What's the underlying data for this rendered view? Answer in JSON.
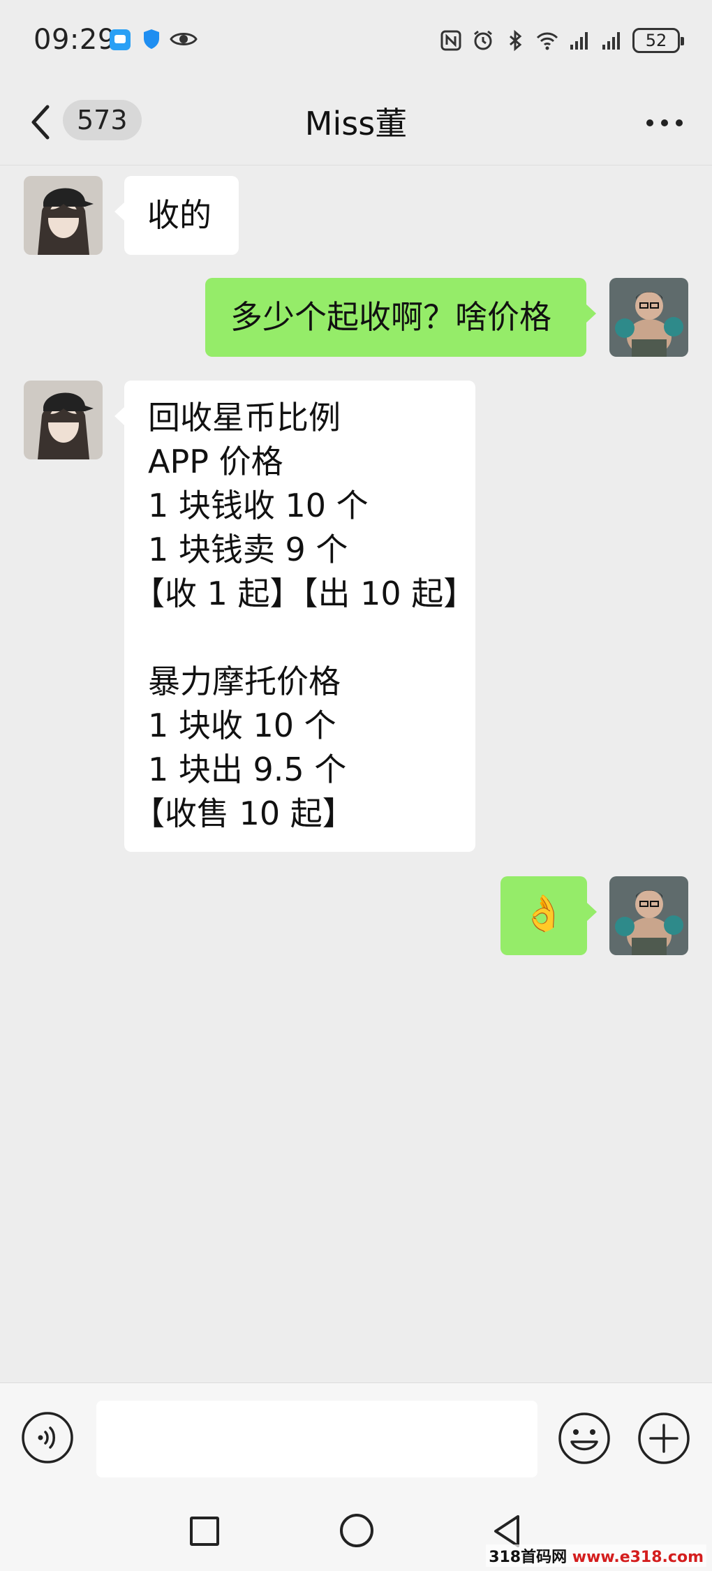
{
  "status_bar": {
    "time": "09:29",
    "battery": "52",
    "icons": [
      "message-app-icon",
      "shield-app-icon",
      "eye-icon",
      "nfc-icon",
      "alarm-icon",
      "bluetooth-icon",
      "wifi-icon",
      "signal-icon",
      "signal-icon",
      "battery-icon"
    ]
  },
  "header": {
    "back_icon": "chevron-left-icon",
    "unread_count": "573",
    "title": "Miss董",
    "more_icon": "more-dots-icon"
  },
  "messages": [
    {
      "side": "in",
      "lines": [
        "收的"
      ]
    },
    {
      "side": "out",
      "lines": [
        "多少个起收啊？啥价格"
      ]
    },
    {
      "side": "in",
      "lines": [
        "回收星币比例",
        "APP 价格",
        "1 块钱收 10 个",
        "1 块钱卖 9 个",
        "【收 1 起】【出 10 起】",
        "",
        "暴力摩托价格",
        "1 块收 10 个",
        "1 块出 9.5 个",
        "【收售 10 起】"
      ]
    },
    {
      "side": "out",
      "emoji": "ok-hand-emoji",
      "lines": [
        "👌"
      ]
    }
  ],
  "input_bar": {
    "voice_icon": "voice-icon",
    "text_value": "",
    "emoji_icon": "emoji-icon",
    "plus_icon": "plus-icon"
  },
  "watermark": {
    "part1": "318首码网",
    "part2": " www.e318.com"
  },
  "colors": {
    "background": "#ededed",
    "incoming_bubble": "#ffffff",
    "outgoing_bubble": "#95ec69"
  }
}
